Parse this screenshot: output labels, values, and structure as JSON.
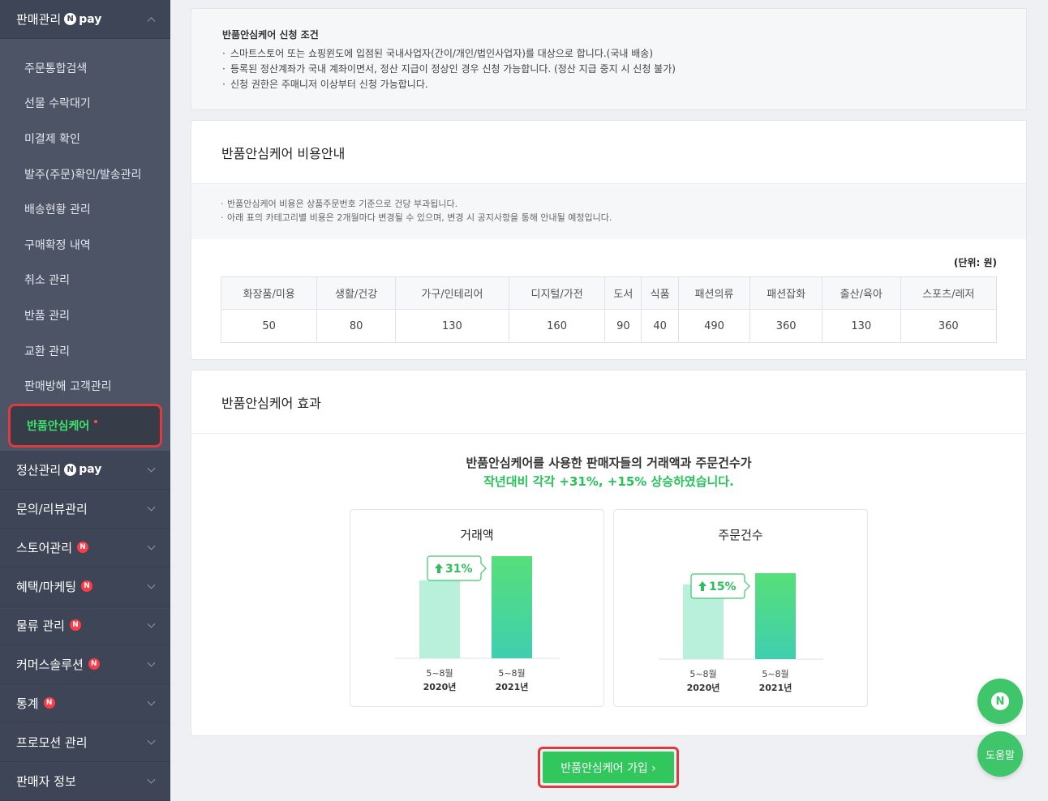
{
  "sidebar": {
    "top_section": {
      "label": "판매관리",
      "pay_label": "pay"
    },
    "sub_items": [
      "주문통합검색",
      "선물 수락대기",
      "미결제 확인",
      "발주(주문)확인/발송관리",
      "배송현황 관리",
      "구매확정 내역",
      "취소 관리",
      "반품 관리",
      "교환 관리",
      "판매방해 고객관리"
    ],
    "active_item": "반품안심케어",
    "sections": [
      {
        "label": "정산관리",
        "pay": "pay"
      },
      {
        "label": "문의/리뷰관리"
      },
      {
        "label": "스토어관리",
        "badge": "N"
      },
      {
        "label": "혜택/마케팅",
        "badge": "N"
      },
      {
        "label": "물류 관리",
        "badge": "N"
      },
      {
        "label": "커머스솔루션",
        "badge": "N"
      },
      {
        "label": "통계",
        "badge": "N"
      },
      {
        "label": "프로모션 관리"
      },
      {
        "label": "판매자 정보"
      }
    ]
  },
  "conditions": {
    "title": "반품안심케어 신청 조건",
    "items": [
      "스마트스토어 또는 쇼핑윈도에 입점된 국내사업자(간이/개인/법인사업자)를 대상으로 합니다.(국내 배송)",
      "등록된 정산계좌가 국내 계좌이면서, 정산 지급이 정상인 경우 신청 가능합니다. (정산 지급 중지 시 신청 불가)",
      "신청 권한은 주매니저 이상부터 신청 가능합니다."
    ]
  },
  "cost": {
    "title": "반품안심케어 비용안내",
    "notes": [
      "반품안심케어 비용은 상품주문번호 기준으로 건당 부과됩니다.",
      "아래 표의 카테고리별 비용은 2개월마다 변경될 수 있으며, 변경 시 공지사항을 통해 안내될 예정입니다."
    ],
    "unit": "(단위: 원)",
    "headers": [
      "화장품/미용",
      "생활/건강",
      "가구/인테리어",
      "디지털/가전",
      "도서",
      "식품",
      "패션의류",
      "패션잡화",
      "출산/육아",
      "스포츠/레저"
    ],
    "values": [
      "50",
      "80",
      "130",
      "160",
      "90",
      "40",
      "490",
      "360",
      "130",
      "360"
    ]
  },
  "effect": {
    "title": "반품안심케어 효과",
    "headline1": "반품안심케어를 사용한 판매자들의 거래액과 주문건수가",
    "headline2": "작년대비 각각 +31%, +15% 상승하였습니다."
  },
  "chart_data": [
    {
      "type": "bar",
      "title": "거래액",
      "categories": [
        "5~8월 2020년",
        "5~8월 2021년"
      ],
      "values": [
        100,
        131
      ],
      "annotation": "31%",
      "colors": [
        "#b8f0dc",
        "#3ddc84"
      ]
    },
    {
      "type": "bar",
      "title": "주문건수",
      "categories": [
        "5~8월 2020년",
        "5~8월 2021년"
      ],
      "values": [
        100,
        115
      ],
      "annotation": "15%",
      "colors": [
        "#b8f0dc",
        "#3ddc84"
      ]
    }
  ],
  "chart_labels": {
    "period": "5~8월",
    "year_prev": "2020년",
    "year_curr": "2021년"
  },
  "join_button": "반품안심케어 가입 ›",
  "help_label": "도움말",
  "fab_n": "N"
}
